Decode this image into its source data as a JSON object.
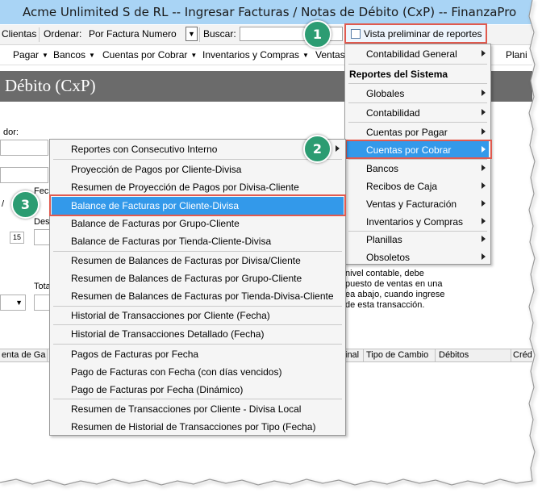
{
  "window": {
    "title": "Acme Unlimited S de RL -- Ingresar Facturas / Notas de Débito (CxP) -- FinanzaPro"
  },
  "toolbar": {
    "clientes": "Clientas",
    "ordenar_label": "Ordenar:",
    "ordenar_value": "Por Factura Numero",
    "buscar_label": "Buscar:",
    "vista_button": "Vista preliminar de reportes"
  },
  "menubar": {
    "items": [
      "Pagar",
      "Bancos",
      "Cuentas por Cobrar",
      "Inventarios y Compras",
      "Ventas",
      "Plani"
    ]
  },
  "page": {
    "title": "Débito (CxP)"
  },
  "form": {
    "dor_label": "dor:",
    "fec_label": "Fec",
    "des_label": "Des",
    "tota_label": "Tota",
    "slash": "/",
    "cal": "15",
    "note_lines": [
      "nivel contable, debe",
      "puesto de ventas en una",
      "ea abajo, cuando ingrese",
      "de esta transacción."
    ]
  },
  "grid": {
    "columns": [
      "enta de Ga",
      "inal",
      "Tipo de Cambio",
      "Débitos",
      "Créd"
    ]
  },
  "main_menu": {
    "items": [
      "Contabilidad General",
      "Reportes del Sistema",
      "Globales",
      "Contabilidad",
      "Cuentas por Pagar",
      "Cuentas por Cobrar",
      "Bancos",
      "Recibos de Caja",
      "Ventas y Facturación",
      "Inventarios y Compras",
      "Planillas",
      "Obsoletos"
    ]
  },
  "sub_menu": {
    "items": [
      "Reportes con Consecutivo Interno",
      "Proyección de Pagos por Cliente-Divisa",
      "Resumen de Proyección de Pagos por Divisa-Cliente",
      "Balance de Facturas por Cliente-Divisa",
      "Balance de Facturas por Grupo-Cliente",
      "Balance de Facturas por Tienda-Cliente-Divisa",
      "Resumen de Balances de Facturas por Divisa/Cliente",
      "Resumen de Balances de Facturas por Grupo-Cliente",
      "Resumen de Balances de Facturas por Tienda-Divisa-Cliente",
      "Historial de Transacciones por Cliente (Fecha)",
      "Historial de Transacciones Detallado (Fecha)",
      "Pagos de Facturas por Fecha",
      "Pago de Facturas con Fecha (con días vencidos)",
      "Pago de Facturas por Fecha (Dinámico)",
      "Resumen de Transacciones por Cliente - Divisa Local",
      "Resumen de Historial de Transacciones por Tipo (Fecha)"
    ]
  },
  "badges": [
    "1",
    "2",
    "3"
  ],
  "colors": {
    "highlight": "#3399ea",
    "callout_border": "#e05a4f",
    "badge": "#2c9c72",
    "titlebar": "#a9d4f5"
  }
}
